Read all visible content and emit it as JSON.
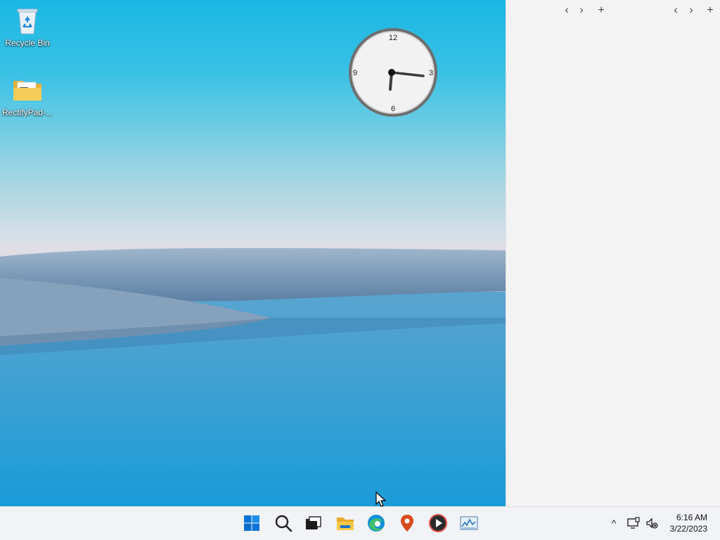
{
  "desktop": {
    "icons": [
      {
        "label": "Recycle Bin",
        "icon": "recycle-bin-icon"
      },
      {
        "label": "RectifyPad-...",
        "icon": "folder-icon"
      }
    ]
  },
  "clock_gadget": {
    "numerals": [
      "12",
      "3",
      "6",
      "9"
    ],
    "time_shown": "6:16"
  },
  "panel": {
    "left_group": {
      "back": "‹",
      "forward": "›",
      "add": "+"
    },
    "right_group": {
      "back": "‹",
      "forward": "›",
      "add": "+"
    }
  },
  "taskbar": {
    "apps": [
      "start-icon",
      "search-icon",
      "task-view-icon",
      "file-explorer-icon",
      "edge-icon",
      "maps-icon",
      "media-player-icon",
      "monitor-app-icon"
    ],
    "tray": {
      "chevron": "^",
      "time": "6:16 AM",
      "date": "3/22/2023"
    }
  },
  "colors": {
    "taskbar_bg": "#f1f3f6",
    "panel_bg": "#f3f3f3",
    "accent_blue": "#0078d4"
  }
}
